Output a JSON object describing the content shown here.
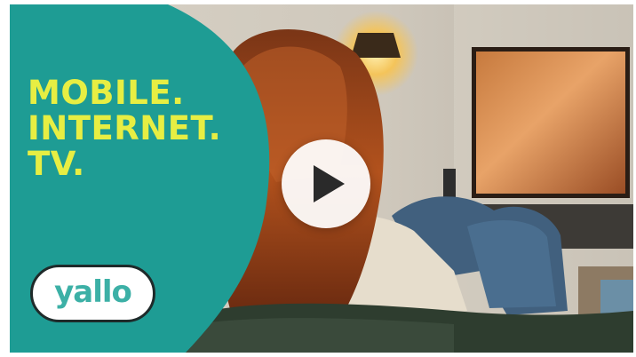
{
  "video": {
    "headline": [
      "MOBILE.",
      "INTERNET.",
      "TV."
    ],
    "brand": "yallo",
    "play_button_icon": "play-icon"
  },
  "colors": {
    "teal": "#1e9c94",
    "headline_yellow": "#e7ee43",
    "logo_text": "#3cb0a6"
  }
}
